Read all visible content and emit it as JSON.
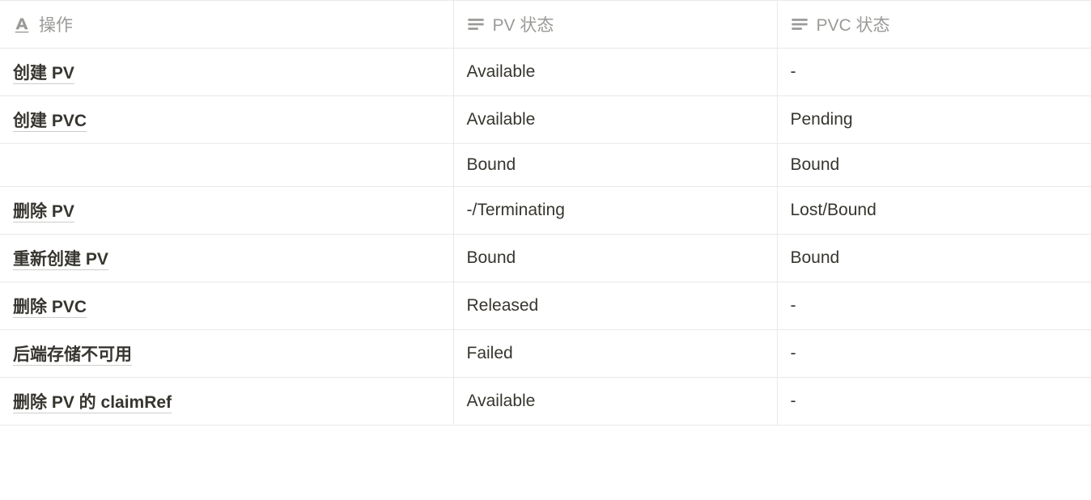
{
  "table": {
    "headers": [
      {
        "label": "操作",
        "icon": "title-icon"
      },
      {
        "label": "PV 状态",
        "icon": "text-icon"
      },
      {
        "label": "PVC 状态",
        "icon": "text-icon"
      }
    ],
    "rows": [
      {
        "operation": "创建 PV",
        "pv_status": "Available",
        "pvc_status": "-"
      },
      {
        "operation": "创建 PVC",
        "pv_status": "Available",
        "pvc_status": "Pending"
      },
      {
        "operation": "",
        "pv_status": "Bound",
        "pvc_status": "Bound"
      },
      {
        "operation": "删除 PV",
        "pv_status": "-/Terminating",
        "pvc_status": "Lost/Bound"
      },
      {
        "operation": "重新创建 PV",
        "pv_status": "Bound",
        "pvc_status": "Bound"
      },
      {
        "operation": "删除 PVC",
        "pv_status": "Released",
        "pvc_status": "-"
      },
      {
        "operation": "后端存储不可用",
        "pv_status": "Failed",
        "pvc_status": "-"
      },
      {
        "operation": "删除 PV 的 claimRef",
        "pv_status": "Available",
        "pvc_status": "-"
      }
    ]
  }
}
